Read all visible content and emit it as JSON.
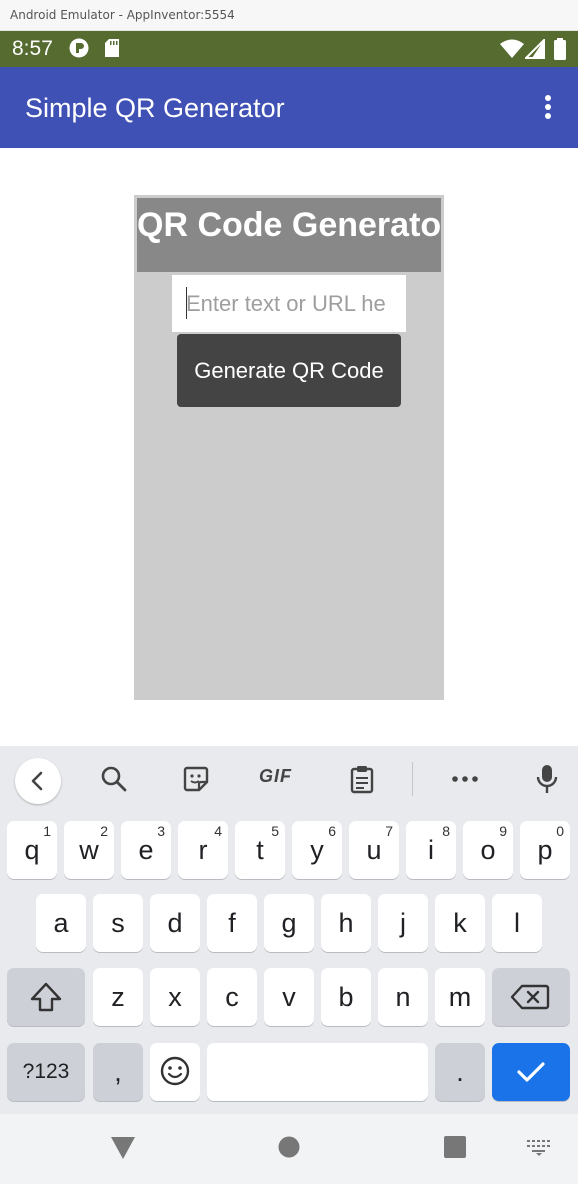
{
  "window": {
    "title": "Android Emulator - AppInventor:5554"
  },
  "status_bar": {
    "time": "8:57",
    "left_icons": [
      "sync-icon",
      "sd-card-icon"
    ],
    "right_icons": [
      "wifi-icon",
      "signal-icon",
      "battery-icon"
    ]
  },
  "app_bar": {
    "title": "Simple QR Generator",
    "menu_icon": "more-vert-icon"
  },
  "main": {
    "heading": "QR Code Generator",
    "input": {
      "placeholder": "Enter text or URL he",
      "value": ""
    },
    "generate_button": "Generate QR Code"
  },
  "keyboard": {
    "toolbar": [
      "back-icon",
      "search-icon",
      "sticker-icon",
      "gif-icon",
      "clipboard-icon",
      "more-icon",
      "mic-icon"
    ],
    "toolbar_gif_label": "GIF",
    "row1": [
      {
        "key": "q",
        "hint": "1"
      },
      {
        "key": "w",
        "hint": "2"
      },
      {
        "key": "e",
        "hint": "3"
      },
      {
        "key": "r",
        "hint": "4"
      },
      {
        "key": "t",
        "hint": "5"
      },
      {
        "key": "y",
        "hint": "6"
      },
      {
        "key": "u",
        "hint": "7"
      },
      {
        "key": "i",
        "hint": "8"
      },
      {
        "key": "o",
        "hint": "9"
      },
      {
        "key": "p",
        "hint": "0"
      }
    ],
    "row2": [
      "a",
      "s",
      "d",
      "f",
      "g",
      "h",
      "j",
      "k",
      "l"
    ],
    "row3": [
      "z",
      "x",
      "c",
      "v",
      "b",
      "n",
      "m"
    ],
    "row4": {
      "symbols": "?123",
      "comma": ",",
      "period": "."
    }
  },
  "nav_bar": [
    "back-icon",
    "home-icon",
    "recents-icon",
    "keyboard-switch-icon"
  ],
  "colors": {
    "status_bar": "#556b2f",
    "app_bar": "#3f51b5",
    "panel": "#cccccc",
    "heading_bg": "#888888",
    "button": "#444444",
    "enter_key": "#1a73e8"
  }
}
